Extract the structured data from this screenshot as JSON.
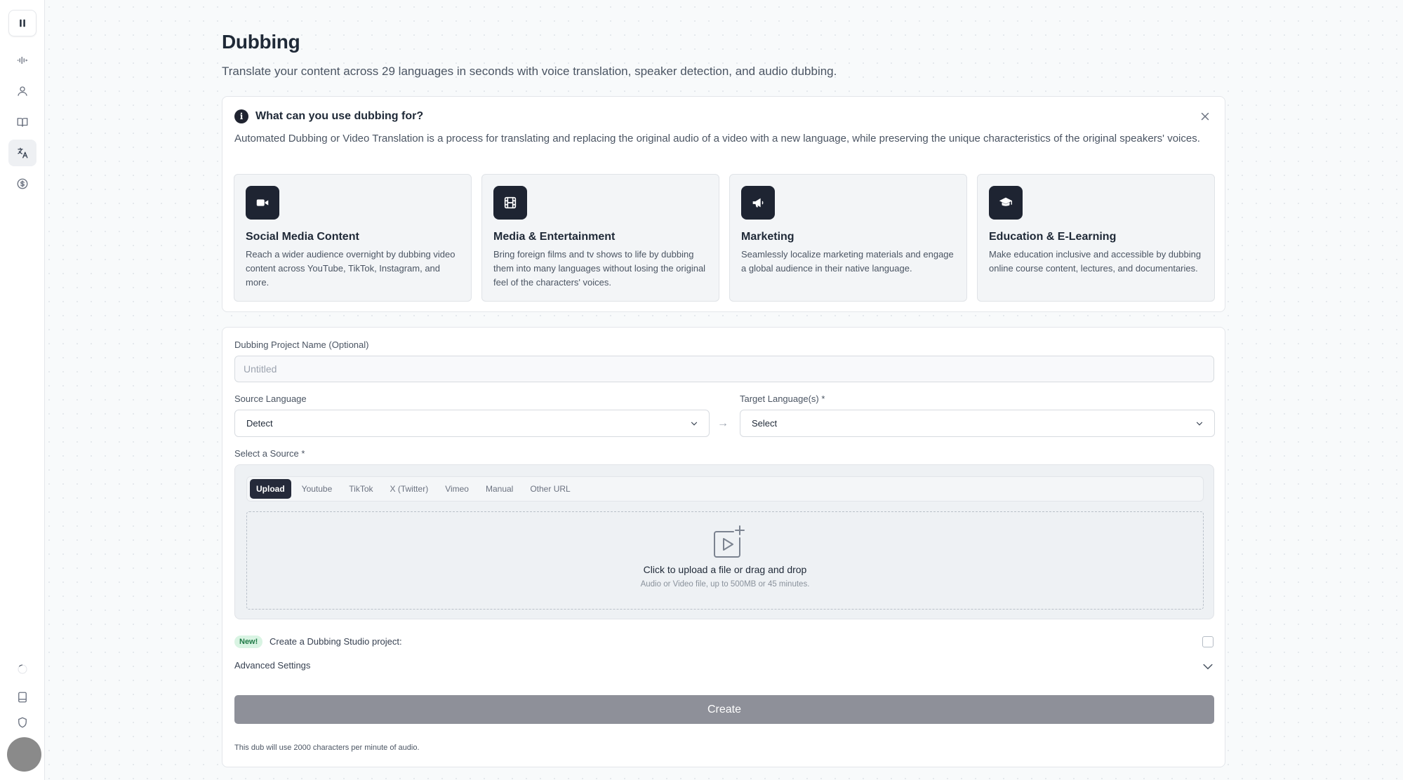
{
  "sidebar": {
    "items": [
      {
        "name": "pause-icon"
      },
      {
        "name": "waveform-icon"
      },
      {
        "name": "voices-icon"
      },
      {
        "name": "book-icon"
      },
      {
        "name": "translate-icon"
      },
      {
        "name": "dollar-icon"
      }
    ],
    "bottom": [
      {
        "name": "spinner-icon"
      },
      {
        "name": "document-icon"
      },
      {
        "name": "shield-icon"
      }
    ]
  },
  "page": {
    "title": "Dubbing",
    "subtitle": "Translate your content across 29 languages in seconds with voice translation, speaker detection, and audio dubbing."
  },
  "info": {
    "title": "What can you use dubbing for?",
    "description": "Automated Dubbing or Video Translation is a process for translating and replacing the original audio of a video with a new language, while preserving the unique characteristics of the original speakers' voices.",
    "use_cases": [
      {
        "icon": "video-camera-icon",
        "title": "Social Media Content",
        "description": "Reach a wider audience overnight by dubbing video content across YouTube, TikTok, Instagram, and more."
      },
      {
        "icon": "film-icon",
        "title": "Media & Entertainment",
        "description": "Bring foreign films and tv shows to life by dubbing them into many languages without losing the original feel of the characters' voices."
      },
      {
        "icon": "megaphone-icon",
        "title": "Marketing",
        "description": "Seamlessly localize marketing materials and engage a global audience in their native language."
      },
      {
        "icon": "graduation-cap-icon",
        "title": "Education & E-Learning",
        "description": "Make education inclusive and accessible by dubbing online course content, lectures, and documentaries."
      }
    ]
  },
  "form": {
    "project_name_label": "Dubbing Project Name (Optional)",
    "project_name_placeholder": "Untitled",
    "project_name_value": "",
    "source_language_label": "Source Language",
    "source_language_value": "Detect",
    "target_language_label": "Target Language(s) *",
    "target_language_value": "Select",
    "arrow": "→",
    "source_label": "Select a Source *",
    "source_tabs": [
      "Upload",
      "Youtube",
      "TikTok",
      "X (Twitter)",
      "Vimeo",
      "Manual",
      "Other URL"
    ],
    "active_tab": "Upload",
    "upload_title": "Click to upload a file or drag and drop",
    "upload_subtitle": "Audio or Video file, up to 500MB or 45 minutes.",
    "new_badge": "New!",
    "studio_label": "Create a Dubbing Studio project:",
    "studio_checked": false,
    "advanced_label": "Advanced Settings",
    "create_label": "Create",
    "usage_note": "This dub will use 2000 characters per minute of audio."
  },
  "colors": {
    "primary_dark": "#252a3a",
    "button_disabled": "#8e9099",
    "badge_bg": "#d9f4e3",
    "badge_text": "#1f7a46"
  }
}
